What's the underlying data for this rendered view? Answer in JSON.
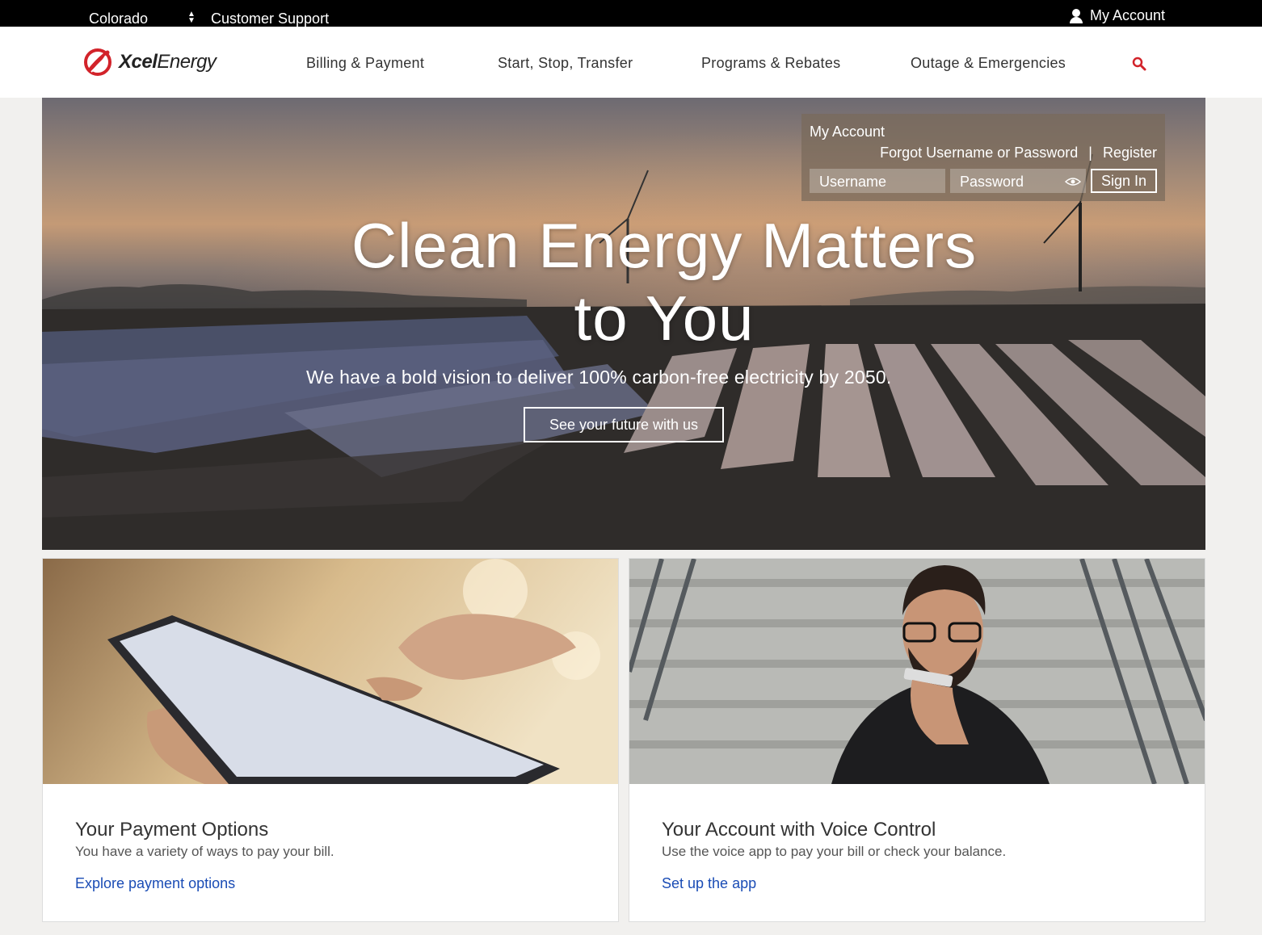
{
  "topbar": {
    "state": "Colorado",
    "support": "Customer Support",
    "account": "My Account"
  },
  "header": {
    "logo_bold": "Xcel",
    "logo_rest": "Energy",
    "nav": [
      "Billing & Payment",
      "Start, Stop, Transfer",
      "Programs & Rebates",
      "Outage & Emergencies"
    ]
  },
  "login": {
    "title": "My Account",
    "forgot": "Forgot Username or Password",
    "separator": "|",
    "register": "Register",
    "username_placeholder": "Username",
    "password_placeholder": "Password",
    "signin": "Sign In"
  },
  "hero": {
    "title_line1": "Clean Energy Matters",
    "title_line2": "to You",
    "subtitle": "We have a bold vision to deliver 100% carbon-free electricity by 2050.",
    "button": "See your future with us"
  },
  "cards": [
    {
      "title": "Your Payment Options",
      "text": "You have a variety of ways to pay your bill.",
      "link": "Explore payment options"
    },
    {
      "title": "Your Account with Voice Control",
      "text": "Use the voice app to pay your bill or check your balance.",
      "link": "Set up the app"
    }
  ],
  "colors": {
    "brand_red": "#d2232a",
    "link_blue": "#1a4cb5",
    "topbar": "#000000"
  }
}
